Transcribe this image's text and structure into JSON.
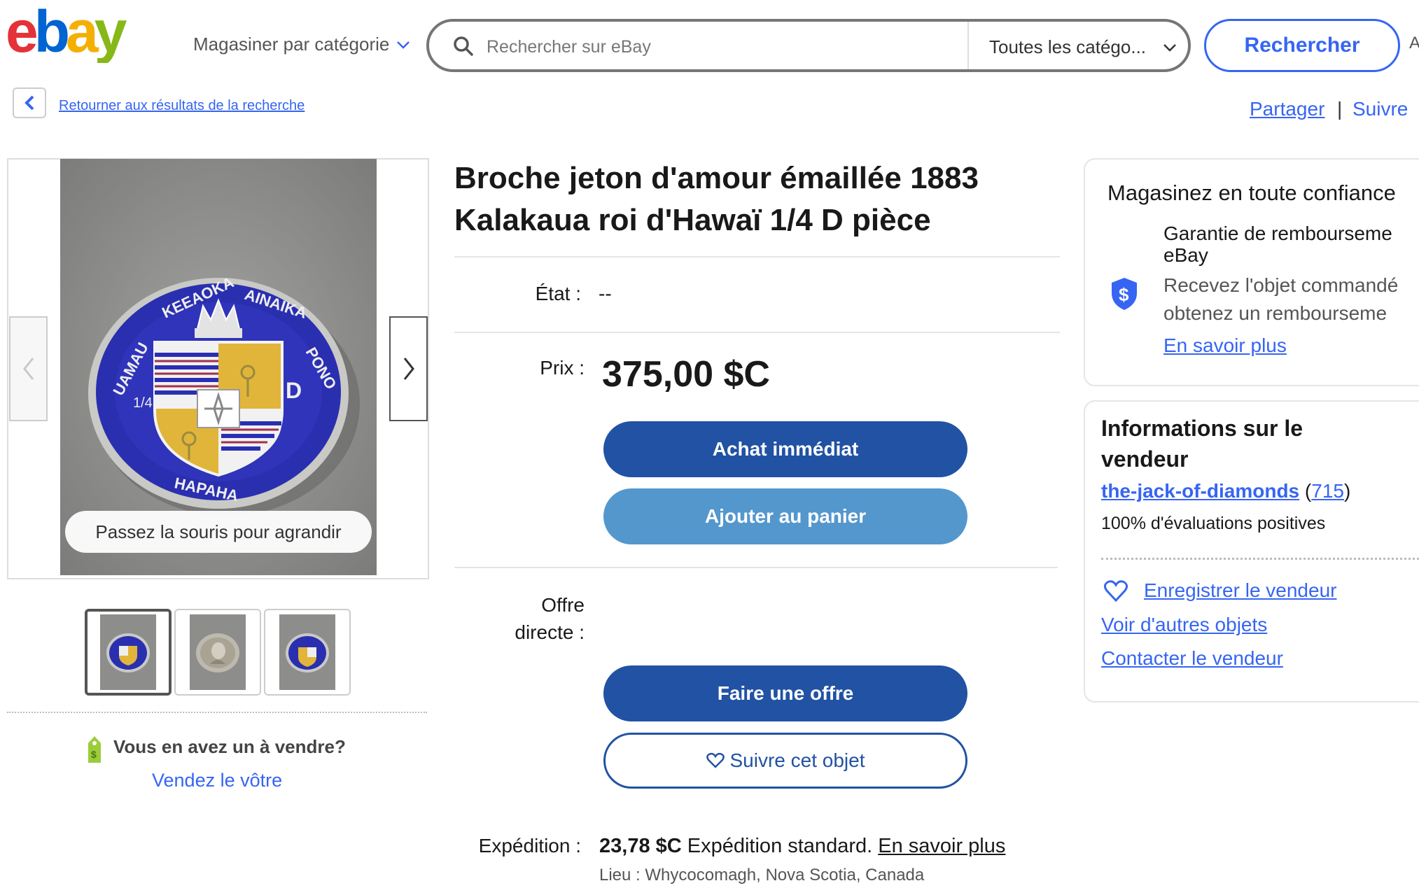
{
  "header": {
    "logo_text": [
      "e",
      "b",
      "a",
      "y"
    ],
    "logo_colors": [
      "#e53238",
      "#0064d2",
      "#f5af02",
      "#86b817"
    ],
    "shop_by_category": "Magasiner par catégorie",
    "search_placeholder": "Rechercher sur eBay",
    "category_select": "Toutes les catégo...",
    "search_button": "Rechercher",
    "advanced_cut": "A"
  },
  "subnav": {
    "back_link": "Retourner aux résultats de la recherche",
    "share": "Partager",
    "separator": "|",
    "follow": "Suivre"
  },
  "gallery": {
    "hover_hint": "Passez la souris pour agrandir",
    "selected_thumbnail": 1,
    "thumbnail_count": 3
  },
  "sell_box": {
    "question": "Vous en avez un à vendre?",
    "link": "Vendez le vôtre"
  },
  "item": {
    "title_line1": "Broche jeton d'amour émaillée 1883",
    "title_line2": "Kalakaua roi d'Hawaï 1/4 D pièce",
    "condition_label": "État :",
    "condition_value": "--",
    "price_label": "Prix :",
    "price": "375,00 $C",
    "buy_now": "Achat immédiat",
    "add_to_cart": "Ajouter au panier",
    "best_offer_label_1": "Offre",
    "best_offer_label_2": "directe :",
    "make_offer": "Faire une offre",
    "watch": "Suivre cet objet",
    "shipping_label": "Expédition :",
    "shipping_price": "23,78 $C",
    "shipping_type": "Expédition standard.",
    "shipping_more": "En savoir plus",
    "location": "Lieu : Whycocomagh, Nova Scotia, Canada"
  },
  "confidence": {
    "title": "Magasinez en toute confiance",
    "guarantee_line1": "Garantie de rembourseme",
    "guarantee_line2": "eBay",
    "desc_line1": "Recevez l'objet commandé",
    "desc_line2": "obtenez un rembourseme",
    "learn_more": "En savoir plus"
  },
  "seller": {
    "title": "Informations sur le vendeur",
    "name": "the-jack-of-diamonds",
    "feedback_count": "715",
    "positive": "100% d'évaluations positives",
    "save": "Enregistrer le vendeur",
    "other_items": "Voir d'autres objets",
    "contact": "Contacter le vendeur"
  },
  "colors": {
    "primary_button": "#2152a3",
    "secondary_button": "#5497cd",
    "link": "#3665f3",
    "enamel_blue": "#2a2fb0",
    "enamel_gold": "#e1b53a"
  }
}
